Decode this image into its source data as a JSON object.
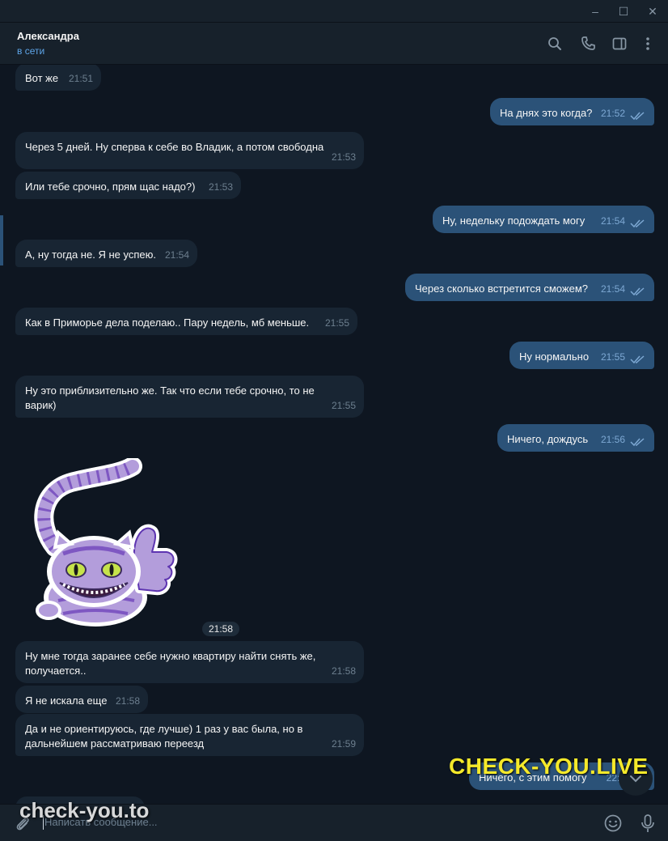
{
  "window": {
    "minimize_glyph": "–",
    "maximize_glyph": "☐",
    "close_glyph": "✕"
  },
  "header": {
    "contact_name": "Александра",
    "status": "в сети",
    "icons": [
      "search-icon",
      "phone-icon",
      "sidebar-toggle-icon",
      "more-vert-icon"
    ]
  },
  "messages": [
    {
      "dir": "in",
      "text": "Вот же",
      "time": "21:51"
    },
    {
      "dir": "out",
      "text": "На днях это когда?",
      "time": "21:52"
    },
    {
      "dir": "in",
      "text": "Через 5 дней. Ну сперва к себе во Владик, а потом свободна",
      "time": "21:53"
    },
    {
      "dir": "in",
      "text": "Или тебе срочно, прям щас надо?)",
      "time": "21:53"
    },
    {
      "dir": "out",
      "text": "Ну, недельку подождать могу",
      "time": "21:54"
    },
    {
      "dir": "in",
      "text": "А, ну тогда не. Я не успею.",
      "time": "21:54"
    },
    {
      "dir": "out",
      "text": "Через сколько встретится сможем?",
      "time": "21:54"
    },
    {
      "dir": "in",
      "text": "Как в Приморье дела поделаю.. Пару недель, мб меньше.",
      "time": "21:55"
    },
    {
      "dir": "out",
      "text": "Ну нормально",
      "time": "21:55"
    },
    {
      "dir": "in",
      "text": "Ну это приблизительно же. Так что если тебе срочно, то не варик)",
      "time": "21:55"
    },
    {
      "dir": "out",
      "text": "Ничего, дождусь",
      "time": "21:56"
    },
    {
      "dir": "in",
      "text": "Ну мне тогда заранее себе нужно квартиру найти снять же, получается..",
      "time": "21:58"
    },
    {
      "dir": "in",
      "text": "Я не искала еще",
      "time": "21:58"
    },
    {
      "dir": "in",
      "text": "Да и не ориентируюсь, где лучше) 1 раз у вас была, но в дальнейшем рассматриваю переезд",
      "time": "21:59"
    },
    {
      "dir": "out",
      "text": "Ничего, с этим помогу",
      "time": "22:0"
    }
  ],
  "sticker": {
    "name": "cheshire-cat-thumbs-up",
    "time": "21:58",
    "colors": {
      "body": "#b39ddb",
      "stripe": "#7e57c2",
      "eye": "#c6e34a"
    }
  },
  "composer": {
    "placeholder": "Написать сообщение..."
  },
  "watermarks": {
    "top": "CHECK-YOU.LIVE",
    "bottom": "check-you.to"
  },
  "colors": {
    "bg": "#0e1621",
    "panel": "#17212b",
    "incoming": "#182533",
    "outgoing": "#2b5278",
    "accent": "#5ea5e8",
    "watermark_yellow": "#f5e92a"
  }
}
